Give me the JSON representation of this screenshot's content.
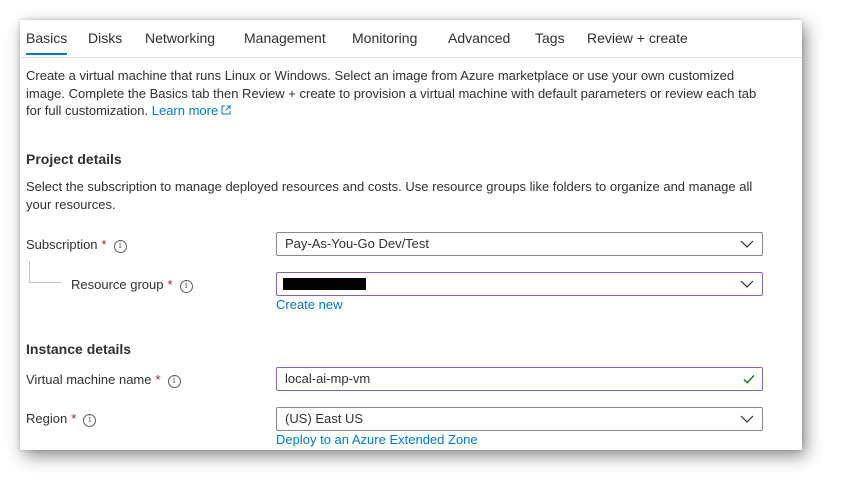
{
  "tabs": [
    "Basics",
    "Disks",
    "Networking",
    "Management",
    "Monitoring",
    "Advanced",
    "Tags",
    "Review + create"
  ],
  "intro": {
    "text": "Create a virtual machine that runs Linux or Windows. Select an image from Azure marketplace or use your own customized image. Complete the Basics tab then Review + create to provision a virtual machine with default parameters or review each tab for full customization.",
    "learn_more": "Learn more"
  },
  "project_details": {
    "heading": "Project details",
    "description": "Select the subscription to manage deployed resources and costs. Use resource groups like folders to organize and manage all your resources.",
    "subscription_label": "Subscription",
    "subscription_value": "Pay-As-You-Go Dev/Test",
    "resource_group_label": "Resource group",
    "resource_group_value": "",
    "create_new": "Create new"
  },
  "instance_details": {
    "heading": "Instance details",
    "vm_name_label": "Virtual machine name",
    "vm_name_value": "local-ai-mp-vm",
    "region_label": "Region",
    "region_value": "(US) East US",
    "extended_zone_link": "Deploy to an Azure Extended Zone"
  },
  "required_marker": "*",
  "info_glyph": "i",
  "icons": {
    "info": "info-icon",
    "dropdown": "chevron-down-icon",
    "valid": "checkmark-icon",
    "external": "external-link-icon"
  },
  "colors": {
    "accent": "#0078d4",
    "required": "#a4262c",
    "focus_border": "#8764b8",
    "valid_check": "#107c10"
  }
}
